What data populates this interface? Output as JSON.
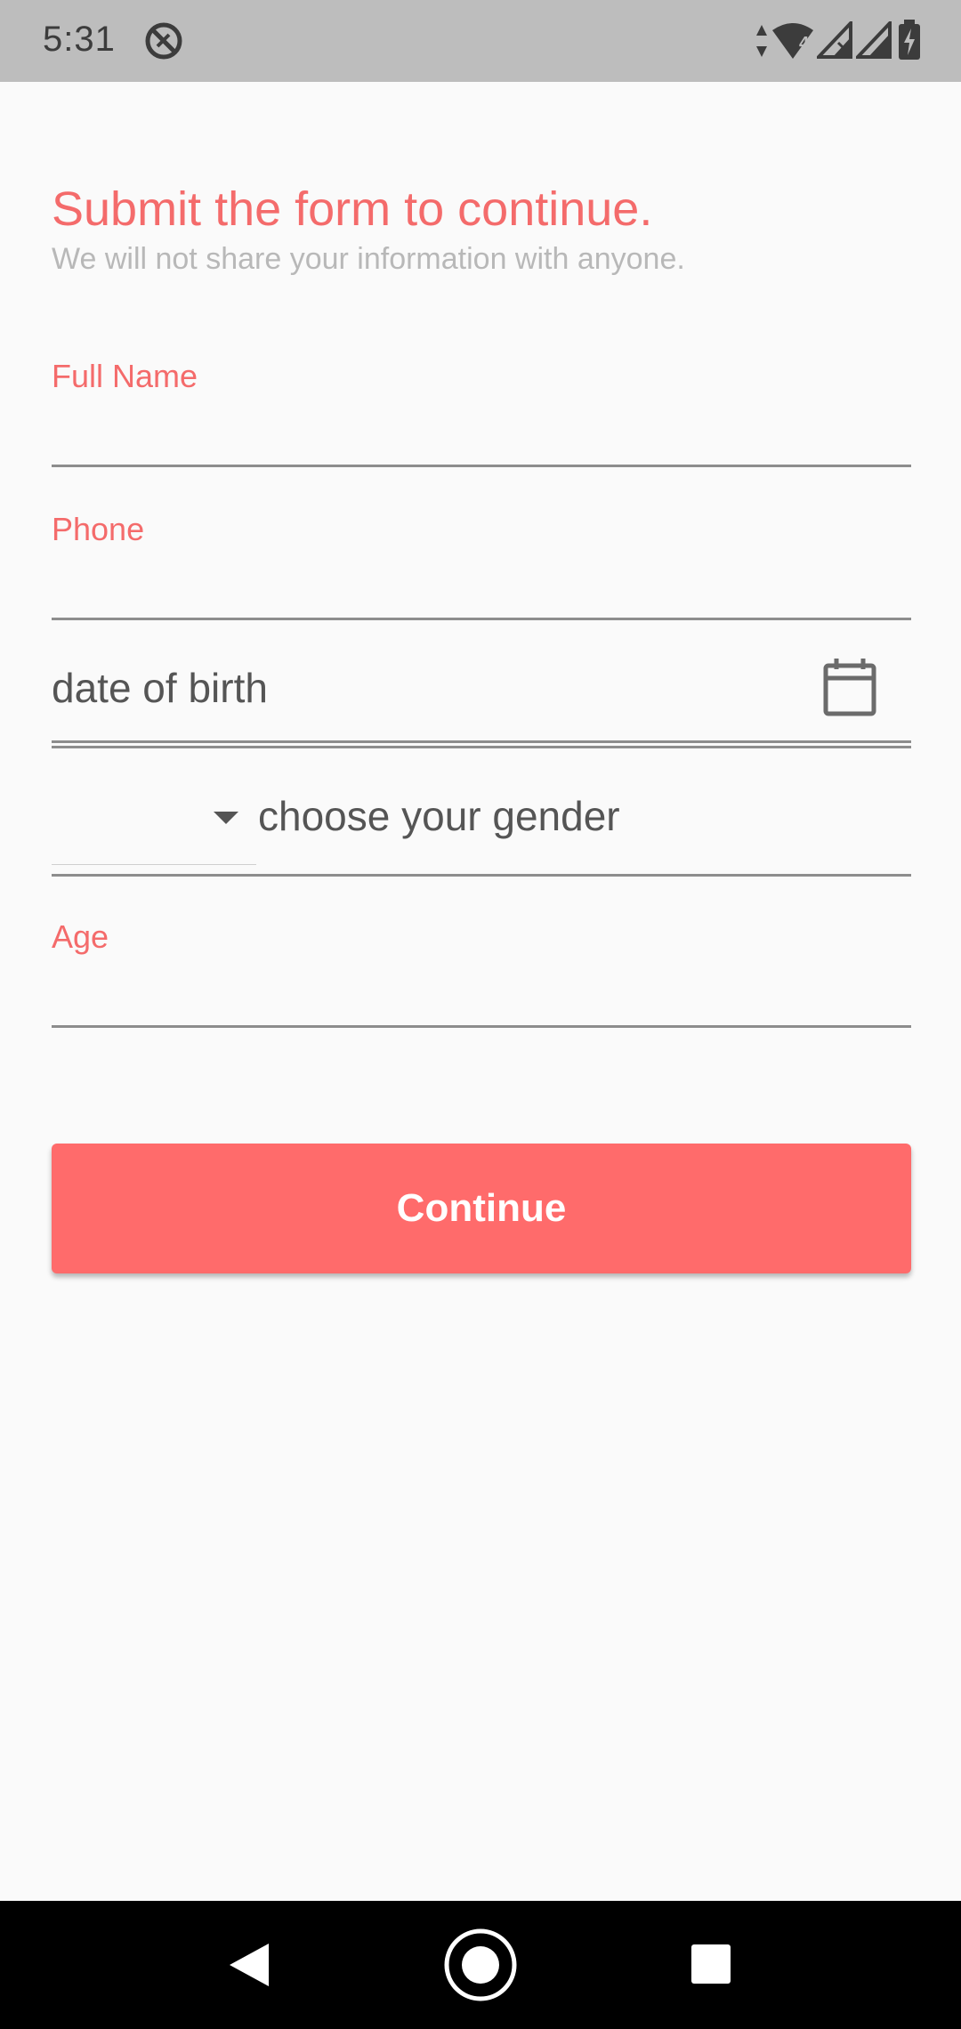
{
  "status_bar": {
    "time": "5:31",
    "icons": [
      "do-not-disturb-icon",
      "wifi-data-icon",
      "signal-icon",
      "signal-no-data-icon",
      "signal-icon",
      "battery-charging-icon"
    ],
    "wifi_badge": "4"
  },
  "form": {
    "title": "Submit the form to continue.",
    "subtitle": "We will not share your information with anyone.",
    "fields": {
      "full_name": {
        "label": "Full Name",
        "value": ""
      },
      "phone": {
        "label": "Phone",
        "value": ""
      },
      "date_of_birth": {
        "placeholder": "date of birth",
        "icon": "calendar-icon"
      },
      "gender": {
        "placeholder": "choose your gender",
        "dropdown_value": "",
        "icon": "dropdown-caret-icon"
      },
      "age": {
        "label": "Age",
        "value": ""
      }
    },
    "continue_label": "Continue"
  },
  "nav_bar": {
    "items": [
      "back-icon",
      "home-icon",
      "recents-icon"
    ]
  },
  "colors": {
    "accent": "#f46b6b",
    "button": "#ff6b6b",
    "subtitle": "#b8b8b8",
    "status_bar": "#bdbdbd",
    "background": "#fafafa",
    "nav_bar": "#000000"
  }
}
